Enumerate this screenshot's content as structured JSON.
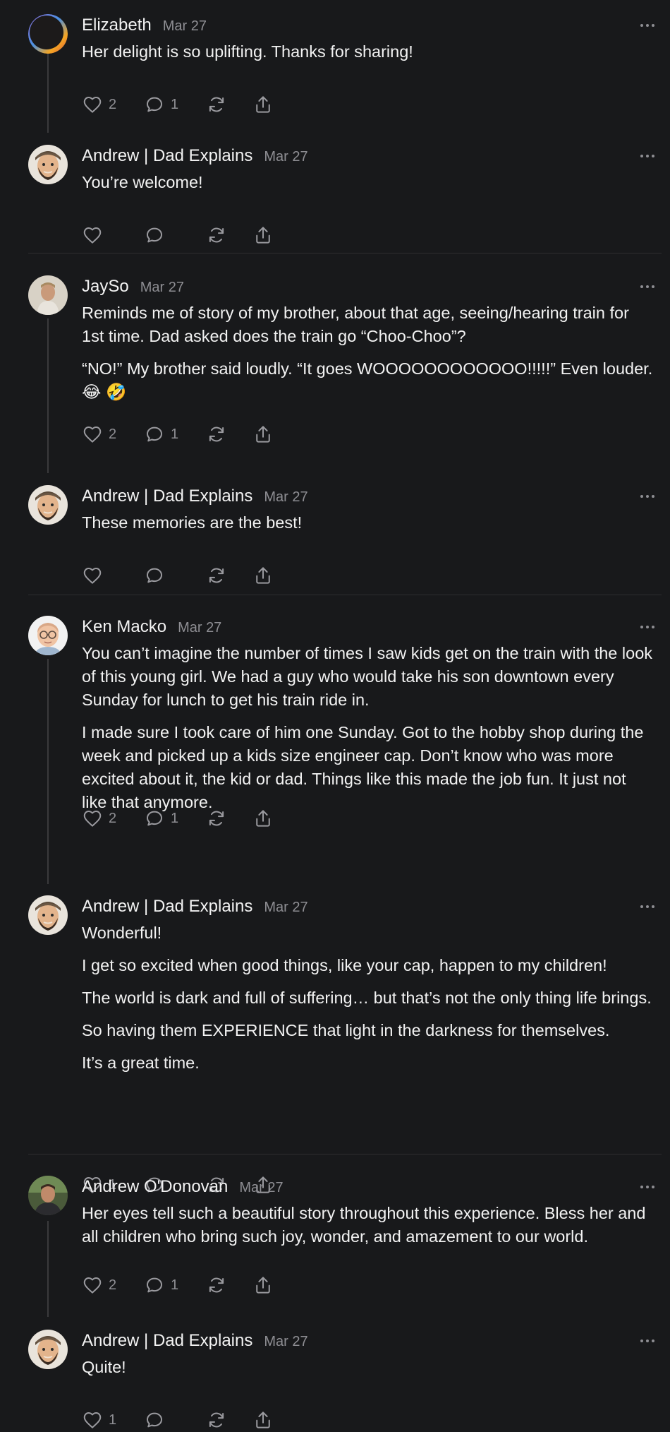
{
  "comments": [
    {
      "author": "Elizabeth",
      "date": "Mar 27",
      "avatar": "dark-rainbow-ring-avatar",
      "paragraphs": [
        "Her delight is so uplifting. Thanks for sharing!"
      ],
      "likes": "2",
      "replies": "1"
    },
    {
      "author": "Andrew | Dad Explains",
      "date": "Mar 27",
      "avatar": "cartoon-bearded-man-avatar",
      "paragraphs": [
        "You’re welcome!"
      ],
      "likes": "",
      "replies": ""
    },
    {
      "author": "JaySo",
      "date": "Mar 27",
      "avatar": "photo-avatar",
      "paragraphs": [
        "Reminds me of story of my brother, about that age, seeing/hearing train for 1st time. Dad asked does the train go “Choo-Choo”?",
        "“NO!” My brother said loudly. “It goes WOOOOOOOOOOOO!!!!!” Even louder. 😂 🤣"
      ],
      "likes": "2",
      "replies": "1"
    },
    {
      "author": "Andrew | Dad Explains",
      "date": "Mar 27",
      "avatar": "cartoon-bearded-man-avatar",
      "paragraphs": [
        "These memories are the best!"
      ],
      "likes": "",
      "replies": ""
    },
    {
      "author": "Ken Macko",
      "date": "Mar 27",
      "avatar": "cartoon-bald-man-glasses-avatar",
      "paragraphs": [
        "You can’t imagine the number of times I saw kids get on the train with the look of this young girl. We had a guy who would take his son downtown every Sunday for lunch to get his train ride in.",
        "I made sure I took care of him one Sunday. Got to the hobby shop during the week and picked up a kids size engineer cap. Don’t know who was more excited about it, the kid or dad. Things like this made the job fun. It just not like that anymore."
      ],
      "likes": "2",
      "replies": "1"
    },
    {
      "author": "Andrew | Dad Explains",
      "date": "Mar 27",
      "avatar": "cartoon-bearded-man-avatar",
      "paragraphs": [
        "Wonderful!",
        "I get so excited when good things, like your cap, happen to my children!",
        "The world is dark and full of suffering… but that’s not the only thing life brings.",
        "So having them EXPERIENCE that light in the darkness for themselves.",
        "It’s a great time."
      ],
      "likes": "1",
      "replies": ""
    },
    {
      "author": "Andrew O'Donovan",
      "date": "Mar 27",
      "avatar": "photo-man-avatar",
      "paragraphs": [
        "Her eyes tell such a beautiful story throughout this experience. Bless her and all children who bring such joy, wonder, and amazement to our world."
      ],
      "likes": "2",
      "replies": "1"
    },
    {
      "author": "Andrew | Dad Explains",
      "date": "Mar 27",
      "avatar": "cartoon-bearded-man-avatar",
      "paragraphs": [
        "Quite!"
      ],
      "likes": "1",
      "replies": ""
    }
  ]
}
